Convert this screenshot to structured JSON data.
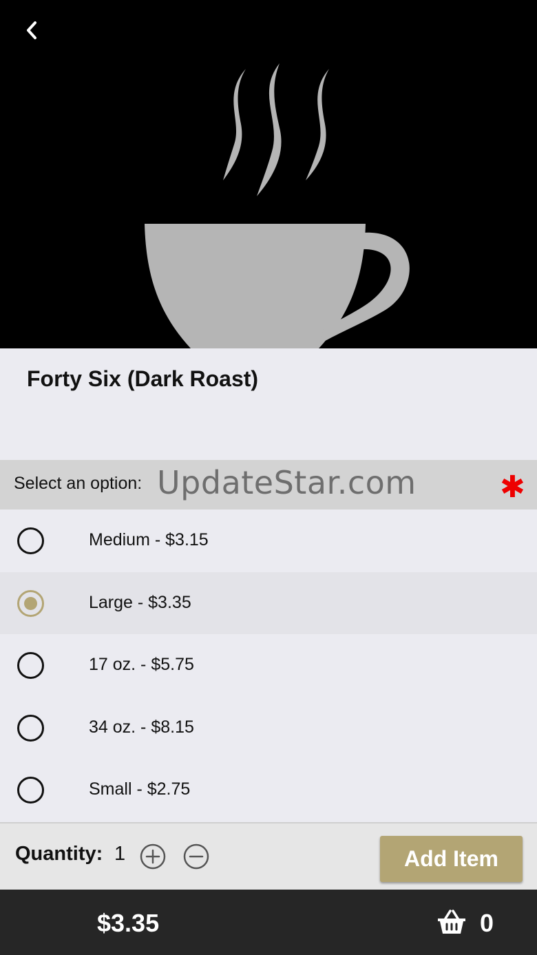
{
  "item": {
    "title": "Forty Six (Dark Roast)"
  },
  "options_section": {
    "header_label": "Select an option:",
    "watermark": "UpdateStar.com",
    "required_marker": "✱",
    "options": [
      {
        "label": "Medium - $3.15",
        "selected": false
      },
      {
        "label": "Large - $3.35",
        "selected": true
      },
      {
        "label": "17 oz. - $5.75",
        "selected": false
      },
      {
        "label": "34 oz. - $8.15",
        "selected": false
      },
      {
        "label": "Small - $2.75",
        "selected": false
      }
    ]
  },
  "quantity": {
    "label": "Quantity:",
    "value": "1",
    "add_button_label": "Add Item"
  },
  "footer": {
    "total": "$3.35",
    "cart_count": "0"
  },
  "colors": {
    "accent": "#b3a574",
    "required": "#ee0000",
    "footer_bg": "#262626",
    "hero_bg": "#000000",
    "cup_color": "#b5b5b5"
  },
  "icons": {
    "back": "chevron-left-icon",
    "cup": "coffee-cup-icon",
    "plus": "plus-circle-icon",
    "minus": "minus-circle-icon",
    "cart": "basket-icon"
  }
}
